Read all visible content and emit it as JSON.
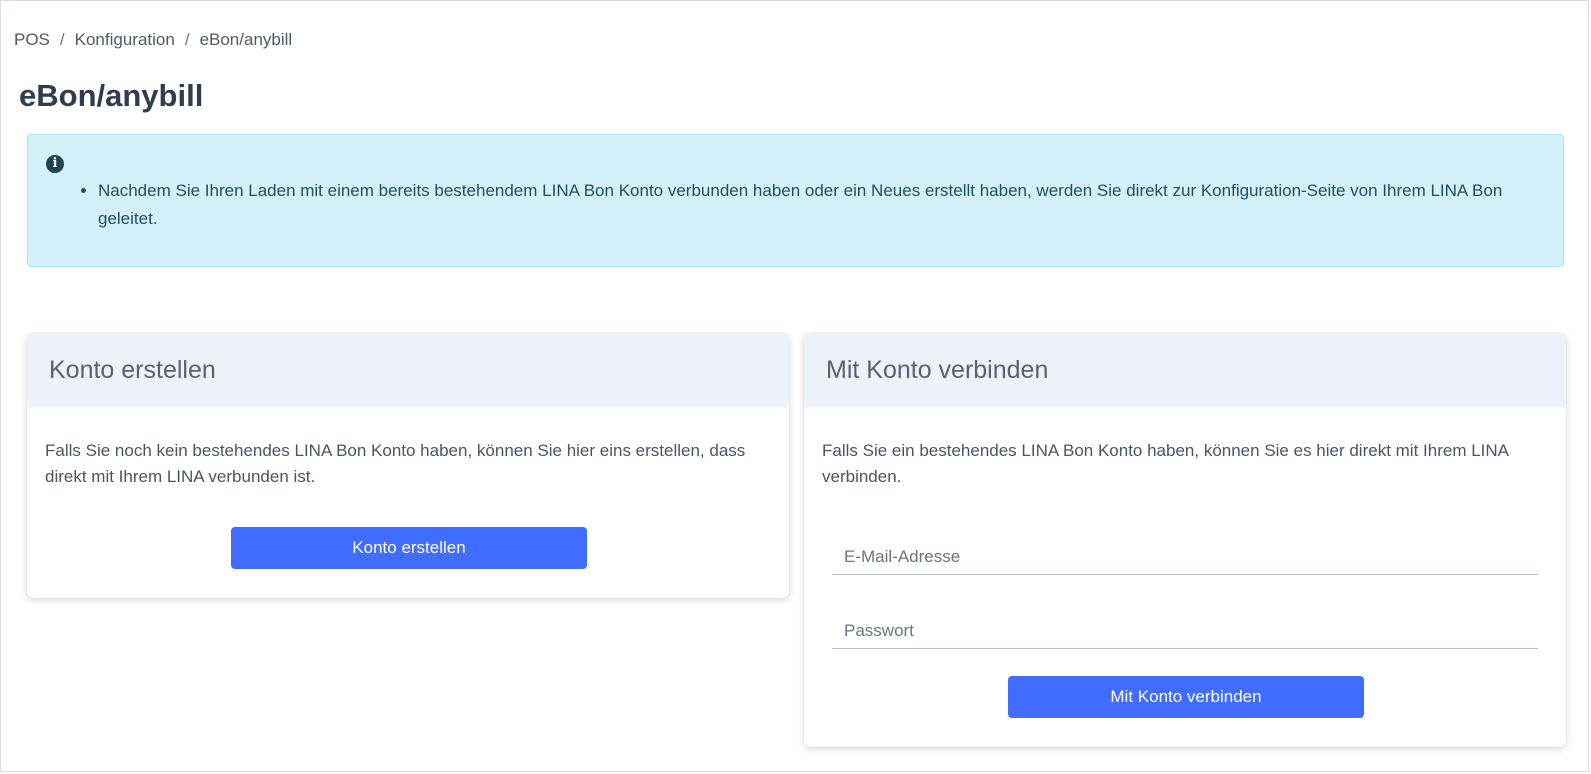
{
  "breadcrumb": {
    "items": [
      "POS",
      "Konfiguration",
      "eBon/anybill"
    ],
    "separator": "/"
  },
  "page_title": "eBon/anybill",
  "info": {
    "icon": "info-circle-icon",
    "items": [
      "Nachdem Sie Ihren Laden mit einem bereits bestehendem LINA Bon Konto verbunden haben oder ein Neues erstellt haben, werden Sie direkt zur Konfiguration-Seite von Ihrem LINA Bon geleitet."
    ]
  },
  "create_card": {
    "title": "Konto erstellen",
    "text": "Falls Sie noch kein bestehendes LINA Bon Konto haben, können Sie hier eins erstellen, dass direkt mit Ihrem LINA verbunden ist.",
    "button_label": "Konto erstellen"
  },
  "connect_card": {
    "title": "Mit Konto verbinden",
    "text": "Falls Sie ein bestehendes LINA Bon Konto haben, können Sie es hier direkt mit Ihrem LINA verbinden.",
    "email_placeholder": "E-Mail-Adresse",
    "email_value": "",
    "password_placeholder": "Passwort",
    "password_value": "",
    "button_label": "Mit Konto verbinden"
  },
  "colors": {
    "primary_button": "#406cff",
    "info_background": "#d4f1fa",
    "info_border": "#a9e2f2",
    "card_header_background": "#edf1f8"
  }
}
